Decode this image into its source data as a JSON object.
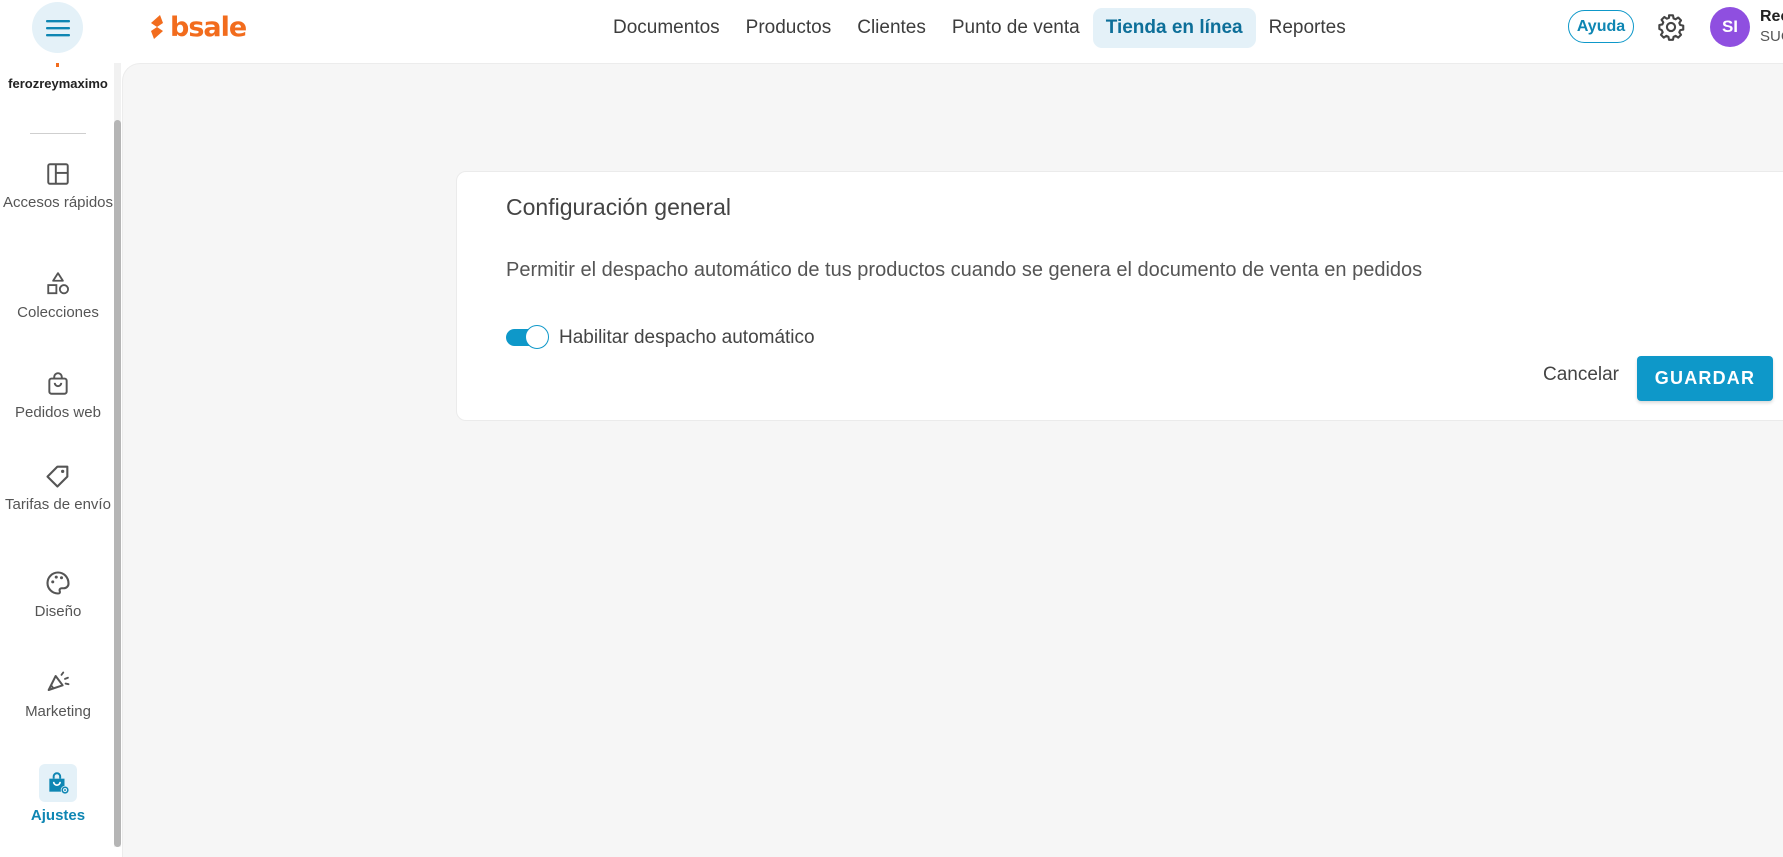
{
  "header": {
    "logo_text": "bsale",
    "nav": [
      {
        "label": "Documentos"
      },
      {
        "label": "Productos"
      },
      {
        "label": "Clientes"
      },
      {
        "label": "Punto de venta"
      },
      {
        "label": "Tienda en línea",
        "active": true
      },
      {
        "label": "Reportes"
      }
    ],
    "help_label": "Ayuda",
    "avatar_initials": "SI",
    "user_name": "Rec",
    "user_sub": "SUC"
  },
  "sidebar": {
    "store_name": "ferozreymaximo",
    "items": [
      {
        "label": "Accesos rápidos",
        "icon": "layout-icon"
      },
      {
        "label": "Colecciones",
        "icon": "shapes-icon"
      },
      {
        "label": "Pedidos web",
        "icon": "shopping-bag-icon"
      },
      {
        "label": "Tarifas de envío",
        "icon": "tag-icon"
      },
      {
        "label": "Diseño",
        "icon": "palette-icon"
      },
      {
        "label": "Marketing",
        "icon": "megaphone-icon"
      },
      {
        "label": "Ajustes",
        "icon": "bag-settings-icon",
        "active": true
      }
    ]
  },
  "card": {
    "title": "Configuración general",
    "description": "Permitir el despacho automático de tus productos cuando se genera el documento de venta en pedidos",
    "toggle_label": "Habilitar despacho automático",
    "toggle_on": true,
    "cancel_label": "Cancelar",
    "save_label": "GUARDAR"
  },
  "colors": {
    "accent": "#0e98c9",
    "brand": "#f26c1d",
    "avatar": "#8f4fe0"
  }
}
